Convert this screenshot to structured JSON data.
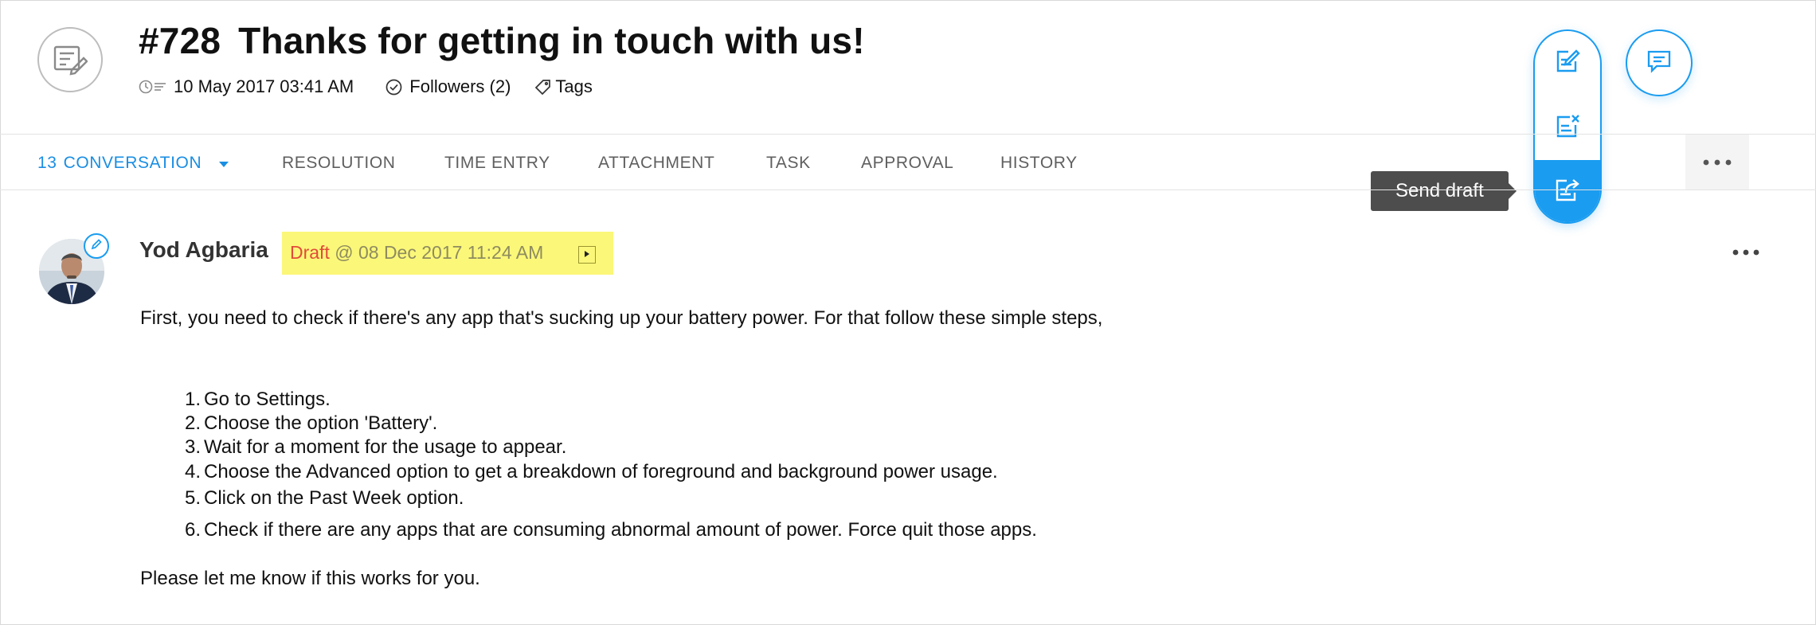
{
  "ticket": {
    "number": "#728",
    "subject": "Thanks for getting in touch with us!",
    "created": "10 May 2017 03:41 AM",
    "followers": "Followers (2)",
    "tags": "Tags"
  },
  "tabs": [
    {
      "count": "13",
      "label": "CONVERSATION",
      "active": true
    },
    {
      "label": "RESOLUTION"
    },
    {
      "label": "TIME ENTRY"
    },
    {
      "label": "ATTACHMENT"
    },
    {
      "label": "TASK"
    },
    {
      "label": "APPROVAL"
    },
    {
      "label": "HISTORY"
    }
  ],
  "message": {
    "author": "Yod Agbaria",
    "draft_label": "Draft",
    "draft_time": " @ 08 Dec 2017 11:24 AM",
    "intro": "First, you need to check if there's any app that's sucking up your battery power. For that follow these simple steps,",
    "steps": [
      "Go to  Settings.",
      "Choose the option 'Battery'.",
      "Wait for a moment for the usage to appear.",
      "Choose the Advanced option to get a breakdown of foreground and background power usage.",
      "Click on the Past Week option.",
      "Check if there are any apps that are consuming abnormal amount of power. Force quit those apps."
    ],
    "outro": "Please let me know if this works for you."
  },
  "actions": {
    "tooltip": "Send draft"
  },
  "colors": {
    "accent": "#1a9cf0",
    "draft_highlight": "#fbf779",
    "draft_label": "#e24a3a",
    "tooltip_bg": "#4d4d4d"
  },
  "icons": [
    "ticket-icon",
    "clock-icon",
    "check-circle-icon",
    "tag-icon",
    "caret-down-icon",
    "more-icon",
    "pencil-icon",
    "play-icon",
    "edit-draft-icon",
    "discard-draft-icon",
    "send-draft-icon",
    "reply-icon"
  ]
}
